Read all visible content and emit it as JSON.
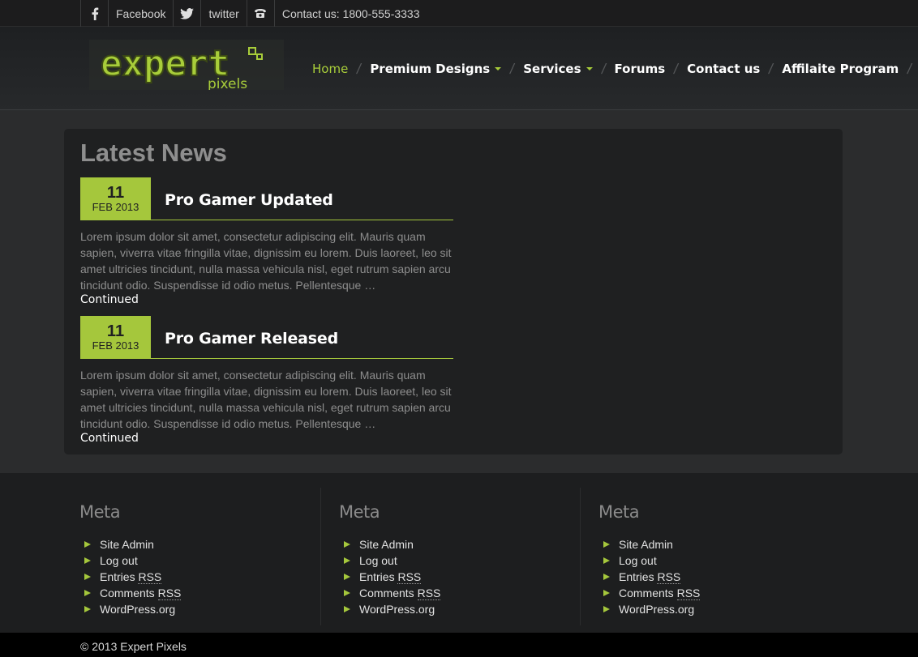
{
  "topbar": {
    "facebook_label": "Facebook",
    "twitter_label": "twitter",
    "contact_label": "Contact us: 1800-555-3333"
  },
  "logo": {
    "text_main": "expert",
    "text_sub": "pixels"
  },
  "nav": {
    "home": "Home",
    "premium": "Premium Designs",
    "services": "Services",
    "forums": "Forums",
    "contact": "Contact us",
    "affiliate": "Affilaite Program"
  },
  "main": {
    "title": "Latest News",
    "posts": [
      {
        "day": "11",
        "month": "FEB 2013",
        "title": "Pro Gamer Updated",
        "excerpt": "Lorem ipsum dolor sit amet, consectetur adipiscing elit. Mauris quam sapien, viverra vitae fringilla vitae, dignissim eu lorem. Duis laoreet, leo sit amet ultricies tincidunt, nulla massa vehicula nisl, eget rutrum sapien arcu tincidunt odio. Suspendisse id odio metus. Pellentesque …",
        "more": "Continued"
      },
      {
        "day": "11",
        "month": "FEB 2013",
        "title": "Pro Gamer Released",
        "excerpt": "Lorem ipsum dolor sit amet, consectetur adipiscing elit. Mauris quam sapien, viverra vitae fringilla vitae, dignissim eu lorem. Duis laoreet, leo sit amet ultricies tincidunt, nulla massa vehicula nisl, eget rutrum sapien arcu tincidunt odio. Suspendisse id odio metus. Pellentesque …",
        "more": "Continued"
      }
    ]
  },
  "footer": {
    "widgets": [
      {
        "title": "Meta",
        "site_admin": "Site Admin",
        "log_out": "Log out",
        "entries": "Entries",
        "comments": "Comments",
        "rss": "RSS",
        "wordpress": "WordPress.org"
      },
      {
        "title": "Meta",
        "site_admin": "Site Admin",
        "log_out": "Log out",
        "entries": "Entries",
        "comments": "Comments",
        "rss": "RSS",
        "wordpress": "WordPress.org"
      },
      {
        "title": "Meta",
        "site_admin": "Site Admin",
        "log_out": "Log out",
        "entries": "Entries",
        "comments": "Comments",
        "rss": "RSS",
        "wordpress": "WordPress.org"
      }
    ],
    "copyright": "© 2013 Expert Pixels"
  },
  "colors": {
    "accent": "#a5c73c",
    "background": "#232425",
    "panel": "#1f2021"
  },
  "icons": [
    "facebook-icon",
    "twitter-icon",
    "phone-icon",
    "caret-down-icon",
    "bullet-arrow-icon"
  ]
}
